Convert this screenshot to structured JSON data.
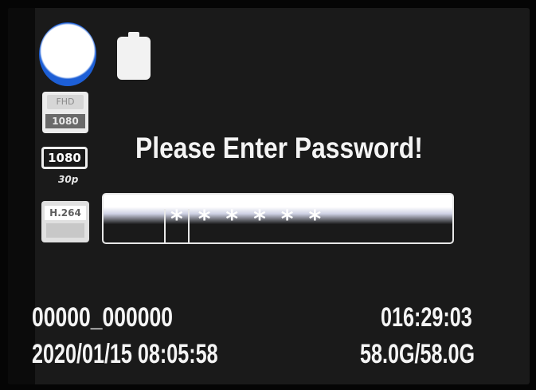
{
  "status": {
    "mode_icon": "camera-mode-icon",
    "battery_icon": "battery-full-icon",
    "resolution_top": "FHD",
    "resolution_label": "1080",
    "framerate_label": "1080",
    "framerate_sub": "30p",
    "codec_label": "H.264"
  },
  "dialog": {
    "prompt": "Please Enter Password!",
    "password_mask": "******"
  },
  "footer": {
    "file_name": "00000_000000",
    "record_time": "016:29:03",
    "date_time": "2020/01/15  08:05:58",
    "storage": "58.0G/58.0G"
  },
  "colors": {
    "screen_bg": "#1a1a1a",
    "text": "#f4f4f4",
    "mode_icon_accent": "#1d5fd6"
  }
}
